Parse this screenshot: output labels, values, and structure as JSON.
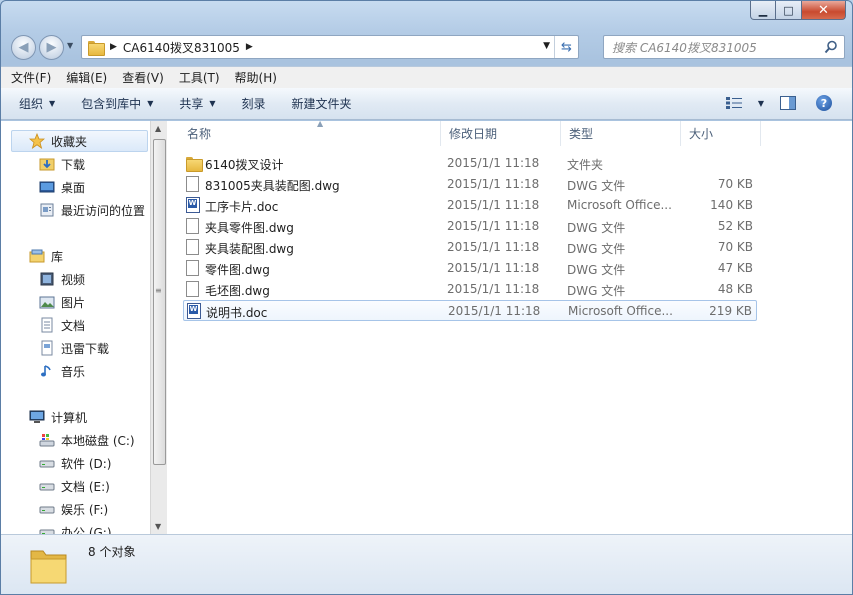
{
  "window": {
    "controls": {
      "minimize": "▁",
      "maximize": "□",
      "close": "✕"
    }
  },
  "address": {
    "path": "CA6140拨叉831005",
    "search_placeholder": "搜索 CA6140拨叉831005"
  },
  "menu": [
    "文件(F)",
    "编辑(E)",
    "查看(V)",
    "工具(T)",
    "帮助(H)"
  ],
  "toolbar": {
    "organize": "组织",
    "include_in_library": "包含到库中",
    "share": "共享",
    "burn": "刻录",
    "new_folder": "新建文件夹"
  },
  "navpane": {
    "favorites": "收藏夹",
    "favorites_items": [
      "下载",
      "桌面",
      "最近访问的位置"
    ],
    "libraries": "库",
    "library_items": [
      "视频",
      "图片",
      "文档",
      "迅雷下载",
      "音乐"
    ],
    "computer": "计算机",
    "drives": [
      "本地磁盘 (C:)",
      "软件 (D:)",
      "文档 (E:)",
      "娱乐 (F:)",
      "办公 (G:)"
    ]
  },
  "columns": {
    "name": "名称",
    "date": "修改日期",
    "type": "类型",
    "size": "大小"
  },
  "files": [
    {
      "name": "6140拨叉设计",
      "date": "2015/1/1 11:18",
      "type": "文件夹",
      "size": "",
      "icon": "folder-icon"
    },
    {
      "name": "831005夹具装配图.dwg",
      "date": "2015/1/1 11:18",
      "type": "DWG 文件",
      "size": "70 KB",
      "icon": "dwg-file-icon"
    },
    {
      "name": "工序卡片.doc",
      "date": "2015/1/1 11:18",
      "type": "Microsoft Office...",
      "size": "140 KB",
      "icon": "word-doc-icon"
    },
    {
      "name": "夹具零件图.dwg",
      "date": "2015/1/1 11:18",
      "type": "DWG 文件",
      "size": "52 KB",
      "icon": "dwg-file-icon"
    },
    {
      "name": "夹具装配图.dwg",
      "date": "2015/1/1 11:18",
      "type": "DWG 文件",
      "size": "70 KB",
      "icon": "dwg-file-icon"
    },
    {
      "name": "零件图.dwg",
      "date": "2015/1/1 11:18",
      "type": "DWG 文件",
      "size": "47 KB",
      "icon": "dwg-file-icon"
    },
    {
      "name": "毛坯图.dwg",
      "date": "2015/1/1 11:18",
      "type": "DWG 文件",
      "size": "48 KB",
      "icon": "dwg-file-icon"
    },
    {
      "name": "说明书.doc",
      "date": "2015/1/1 11:18",
      "type": "Microsoft Office...",
      "size": "219 KB",
      "icon": "word-doc-icon"
    }
  ],
  "status": {
    "count": "8 个对象"
  }
}
